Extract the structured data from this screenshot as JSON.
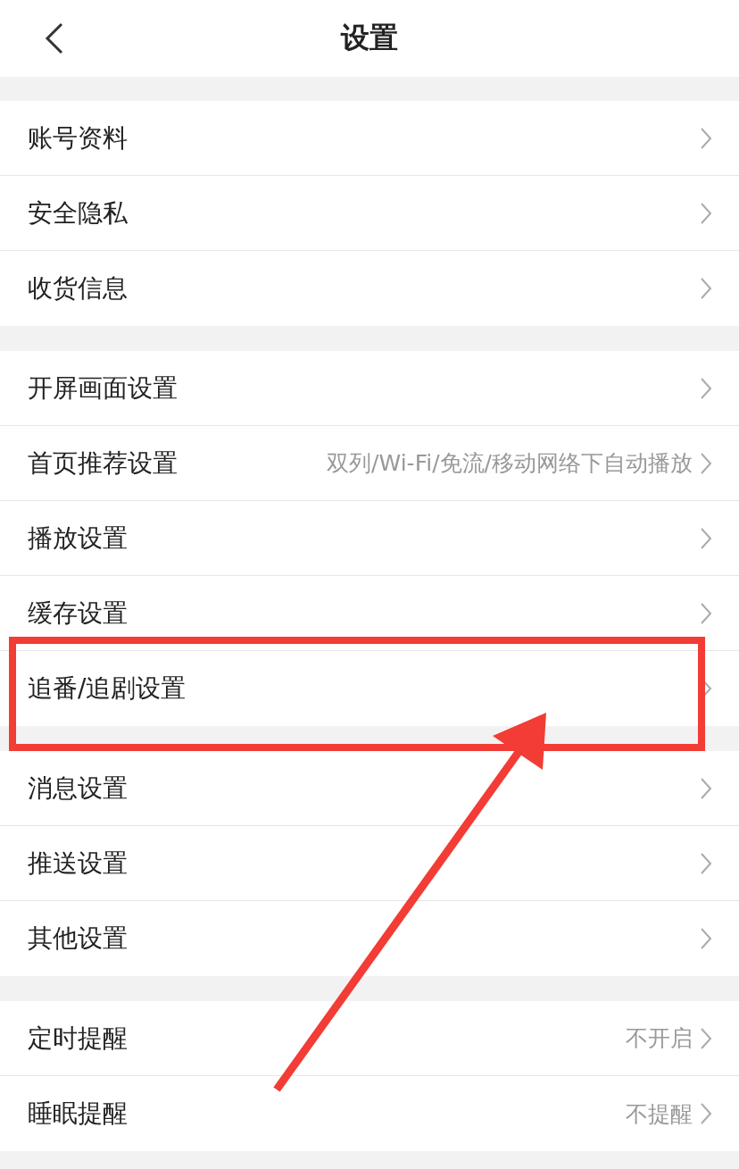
{
  "header": {
    "title": "设置"
  },
  "groups": [
    {
      "items": [
        {
          "label": "账号资料"
        },
        {
          "label": "安全隐私"
        },
        {
          "label": "收货信息"
        }
      ]
    },
    {
      "items": [
        {
          "label": "开屏画面设置"
        },
        {
          "label": "首页推荐设置",
          "value": "双列/Wi-Fi/免流/移动网络下自动播放"
        },
        {
          "label": "播放设置"
        },
        {
          "label": "缓存设置"
        },
        {
          "label": "追番/追剧设置"
        }
      ]
    },
    {
      "items": [
        {
          "label": "消息设置"
        },
        {
          "label": "推送设置"
        },
        {
          "label": "其他设置"
        }
      ]
    },
    {
      "items": [
        {
          "label": "定时提醒",
          "value": "不开启"
        },
        {
          "label": "睡眠提醒",
          "value": "不提醒"
        }
      ]
    }
  ]
}
